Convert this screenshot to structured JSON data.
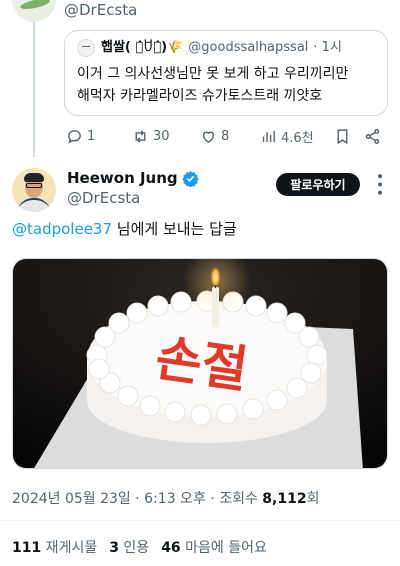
{
  "parent": {
    "handle": "@DrEcsta"
  },
  "quoted": {
    "name": "햅쌀( ꒪̇ꇴ꒪̇)🌾",
    "handle": "@goodssalhapssal",
    "time": "· 1시",
    "text_line1": "이거 그 의사선생님만 못 보게 하고 우리끼리만",
    "text_line2": "해먹자 카라멜라이즈 슈가토스트래 끼얏호"
  },
  "actions": {
    "replies": "1",
    "reposts": "30",
    "likes": "8",
    "views": "4.6천"
  },
  "author": {
    "name": "Heewon Jung",
    "handle": "@DrEcsta",
    "follow_label": "팔로우하기"
  },
  "reply_to": {
    "mention": "@tadpolee37",
    "suffix": " 님에게 보내는 답글"
  },
  "media": {
    "cake_text": "손절"
  },
  "meta": {
    "date": "2024년 05월 23일",
    "sep1": " · ",
    "time": "6:13 오후",
    "sep2": " · ",
    "views_label": "조회수 ",
    "views_value": "8,112",
    "views_suffix": "회"
  },
  "stats": {
    "reposts_num": "111",
    "reposts_label": " 재게시물",
    "quotes_num": "3",
    "quotes_label": " 인용",
    "likes_num": "46",
    "likes_label": " 마음에 들어요"
  },
  "colors": {
    "accent": "#1d9bf0",
    "text": "#0f1419",
    "muted": "#536471",
    "border": "#cfd9de"
  }
}
